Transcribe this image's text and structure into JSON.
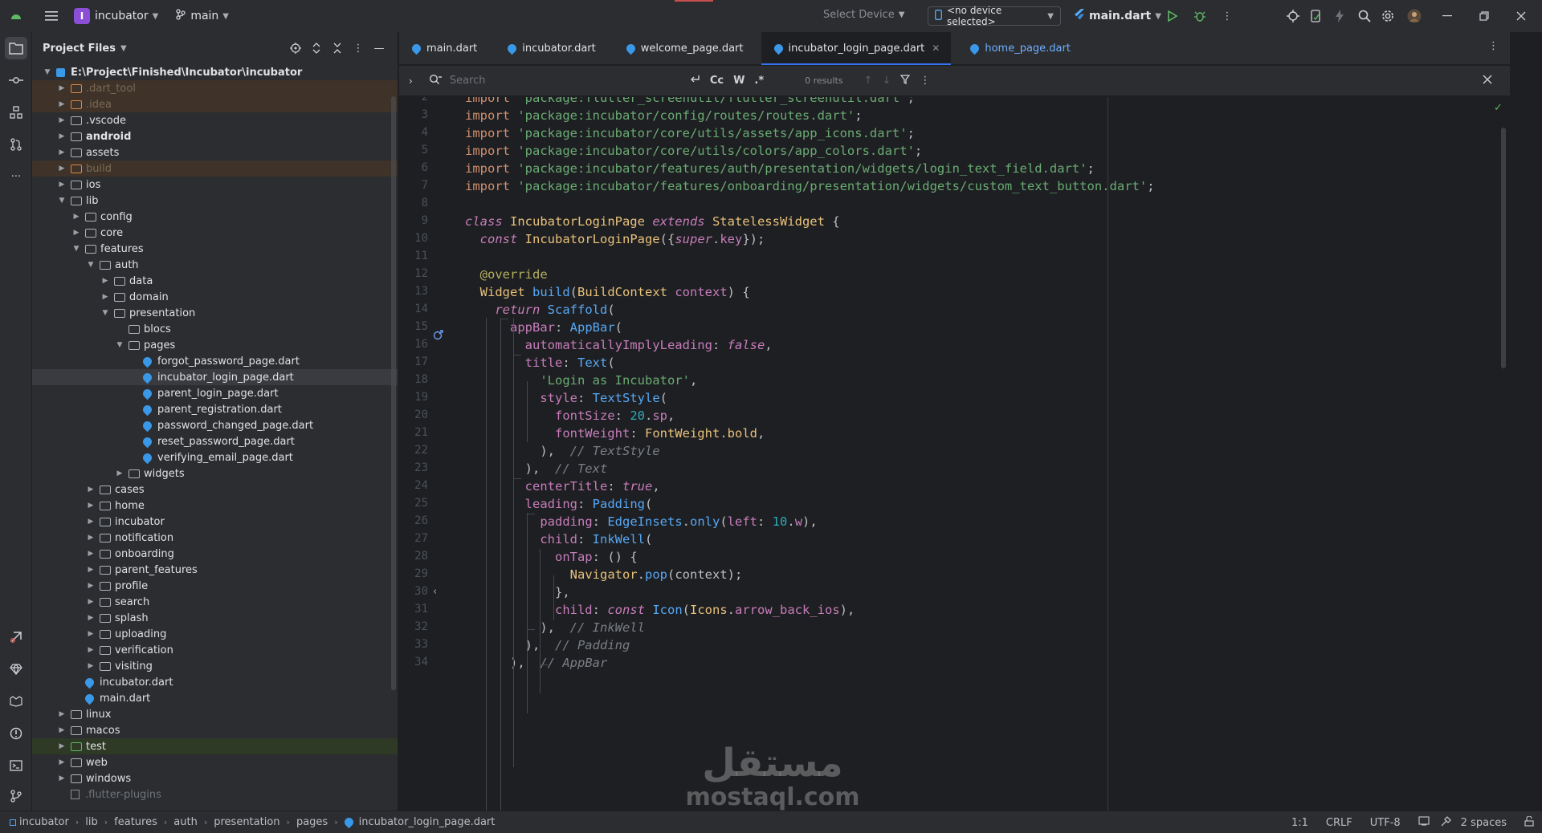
{
  "titlebar": {
    "project_badge": "I",
    "project_name": "incubator",
    "branch": "main",
    "select_device": "Select Device",
    "device_selected": "<no device selected>",
    "run_config": "main.dart",
    "brand_color": "#8a4fd6"
  },
  "project_panel": {
    "title": "Project Files",
    "tree": [
      {
        "label": "E:\\Project\\Finished\\Incubator\\incubator",
        "depth": 0,
        "expanded": true,
        "kind": "root",
        "bold": true
      },
      {
        "label": ".dart_tool",
        "depth": 1,
        "expanded": false,
        "kind": "excluded"
      },
      {
        "label": ".idea",
        "depth": 1,
        "expanded": false,
        "kind": "excluded"
      },
      {
        "label": ".vscode",
        "depth": 1,
        "expanded": false,
        "kind": "folder"
      },
      {
        "label": "android",
        "depth": 1,
        "expanded": false,
        "kind": "folder",
        "bold": true
      },
      {
        "label": "assets",
        "depth": 1,
        "expanded": false,
        "kind": "folder"
      },
      {
        "label": "build",
        "depth": 1,
        "expanded": false,
        "kind": "excluded"
      },
      {
        "label": "ios",
        "depth": 1,
        "expanded": false,
        "kind": "folder"
      },
      {
        "label": "lib",
        "depth": 1,
        "expanded": true,
        "kind": "folder"
      },
      {
        "label": "config",
        "depth": 2,
        "expanded": false,
        "kind": "folder"
      },
      {
        "label": "core",
        "depth": 2,
        "expanded": false,
        "kind": "folder"
      },
      {
        "label": "features",
        "depth": 2,
        "expanded": true,
        "kind": "folder"
      },
      {
        "label": "auth",
        "depth": 3,
        "expanded": true,
        "kind": "folder"
      },
      {
        "label": "data",
        "depth": 4,
        "expanded": false,
        "kind": "folder"
      },
      {
        "label": "domain",
        "depth": 4,
        "expanded": false,
        "kind": "folder"
      },
      {
        "label": "presentation",
        "depth": 4,
        "expanded": true,
        "kind": "folder"
      },
      {
        "label": "blocs",
        "depth": 5,
        "expanded": null,
        "kind": "folder"
      },
      {
        "label": "pages",
        "depth": 5,
        "expanded": true,
        "kind": "folder"
      },
      {
        "label": "forgot_password_page.dart",
        "depth": 6,
        "kind": "dart"
      },
      {
        "label": "incubator_login_page.dart",
        "depth": 6,
        "kind": "dart",
        "selected": true
      },
      {
        "label": "parent_login_page.dart",
        "depth": 6,
        "kind": "dart"
      },
      {
        "label": "parent_registration.dart",
        "depth": 6,
        "kind": "dart"
      },
      {
        "label": "password_changed_page.dart",
        "depth": 6,
        "kind": "dart"
      },
      {
        "label": "reset_password_page.dart",
        "depth": 6,
        "kind": "dart"
      },
      {
        "label": "verifying_email_page.dart",
        "depth": 6,
        "kind": "dart"
      },
      {
        "label": "widgets",
        "depth": 5,
        "expanded": false,
        "kind": "folder"
      },
      {
        "label": "cases",
        "depth": 3,
        "expanded": false,
        "kind": "folder"
      },
      {
        "label": "home",
        "depth": 3,
        "expanded": false,
        "kind": "folder"
      },
      {
        "label": "incubator",
        "depth": 3,
        "expanded": false,
        "kind": "folder"
      },
      {
        "label": "notification",
        "depth": 3,
        "expanded": false,
        "kind": "folder"
      },
      {
        "label": "onboarding",
        "depth": 3,
        "expanded": false,
        "kind": "folder"
      },
      {
        "label": "parent_features",
        "depth": 3,
        "expanded": false,
        "kind": "folder"
      },
      {
        "label": "profile",
        "depth": 3,
        "expanded": false,
        "kind": "folder"
      },
      {
        "label": "search",
        "depth": 3,
        "expanded": false,
        "kind": "folder"
      },
      {
        "label": "splash",
        "depth": 3,
        "expanded": false,
        "kind": "folder"
      },
      {
        "label": "uploading",
        "depth": 3,
        "expanded": false,
        "kind": "folder"
      },
      {
        "label": "verification",
        "depth": 3,
        "expanded": false,
        "kind": "folder"
      },
      {
        "label": "visiting",
        "depth": 3,
        "expanded": false,
        "kind": "folder"
      },
      {
        "label": "incubator.dart",
        "depth": 2,
        "kind": "dart"
      },
      {
        "label": "main.dart",
        "depth": 2,
        "kind": "dart"
      },
      {
        "label": "linux",
        "depth": 1,
        "expanded": false,
        "kind": "folder"
      },
      {
        "label": "macos",
        "depth": 1,
        "expanded": false,
        "kind": "folder"
      },
      {
        "label": "test",
        "depth": 1,
        "expanded": false,
        "kind": "test"
      },
      {
        "label": "web",
        "depth": 1,
        "expanded": false,
        "kind": "folder"
      },
      {
        "label": "windows",
        "depth": 1,
        "expanded": false,
        "kind": "folder"
      },
      {
        "label": ".flutter-plugins",
        "depth": 1,
        "kind": "file"
      }
    ]
  },
  "tabs": [
    {
      "label": "main.dart",
      "active": false,
      "modified": false
    },
    {
      "label": "incubator.dart",
      "active": false,
      "modified": false
    },
    {
      "label": "welcome_page.dart",
      "active": false,
      "modified": false
    },
    {
      "label": "incubator_login_page.dart",
      "active": true,
      "modified": false
    },
    {
      "label": "home_page.dart",
      "active": false,
      "modified": true
    }
  ],
  "findbar": {
    "placeholder": "Search",
    "case_label": "Cc",
    "word_label": "W",
    "regex_label": ".*",
    "results": "0 results"
  },
  "code": {
    "first_line": 2,
    "lines": [
      [
        [
          "kw",
          "import "
        ],
        [
          "str",
          "'package:flutter_screenutil/flutter_screenutil.dart'"
        ],
        [
          "txt",
          ";"
        ]
      ],
      [
        [
          "kw",
          "import "
        ],
        [
          "str",
          "'package:incubator/config/routes/routes.dart'"
        ],
        [
          "txt",
          ";"
        ]
      ],
      [
        [
          "kw",
          "import "
        ],
        [
          "str",
          "'package:incubator/core/utils/assets/app_icons.dart'"
        ],
        [
          "txt",
          ";"
        ]
      ],
      [
        [
          "kw",
          "import "
        ],
        [
          "str",
          "'package:incubator/core/utils/colors/app_colors.dart'"
        ],
        [
          "txt",
          ";"
        ]
      ],
      [
        [
          "kw",
          "import "
        ],
        [
          "str",
          "'package:incubator/features/auth/presentation/widgets/login_text_field.dart'"
        ],
        [
          "txt",
          ";"
        ]
      ],
      [
        [
          "kw",
          "import "
        ],
        [
          "str",
          "'package:incubator/features/onboarding/presentation/widgets/custom_text_button.dart'"
        ],
        [
          "txt",
          ";"
        ]
      ],
      [],
      [
        [
          "kwi",
          "class "
        ],
        [
          "cls",
          "IncubatorLoginPage "
        ],
        [
          "kwi",
          "extends "
        ],
        [
          "cls",
          "StatelessWidget "
        ],
        [
          "txt",
          "{"
        ]
      ],
      [
        [
          "txt",
          "  "
        ],
        [
          "kwi",
          "const "
        ],
        [
          "cls",
          "IncubatorLoginPage"
        ],
        [
          "txt",
          "({"
        ],
        [
          "kwi",
          "super"
        ],
        [
          "txt",
          "."
        ],
        [
          "prop",
          "key"
        ],
        [
          "txt",
          "});"
        ]
      ],
      [],
      [
        [
          "txt",
          "  "
        ],
        [
          "ann",
          "@override"
        ]
      ],
      [
        [
          "txt",
          "  "
        ],
        [
          "cls",
          "Widget "
        ],
        [
          "typ",
          "build"
        ],
        [
          "txt",
          "("
        ],
        [
          "cls",
          "BuildContext "
        ],
        [
          "prop",
          "context"
        ],
        [
          "txt",
          ") {"
        ]
      ],
      [
        [
          "txt",
          "    "
        ],
        [
          "kwi",
          "return "
        ],
        [
          "typ",
          "Scaffold"
        ],
        [
          "txt",
          "("
        ]
      ],
      [
        [
          "txt",
          "      "
        ],
        [
          "prop",
          "appBar"
        ],
        [
          "txt",
          ": "
        ],
        [
          "typ",
          "AppBar"
        ],
        [
          "txt",
          "("
        ]
      ],
      [
        [
          "txt",
          "        "
        ],
        [
          "prop",
          "automaticallyImplyLeading"
        ],
        [
          "txt",
          ": "
        ],
        [
          "kwi",
          "false"
        ],
        [
          "txt",
          ","
        ]
      ],
      [
        [
          "txt",
          "        "
        ],
        [
          "prop",
          "title"
        ],
        [
          "txt",
          ": "
        ],
        [
          "typ",
          "Text"
        ],
        [
          "txt",
          "("
        ]
      ],
      [
        [
          "txt",
          "          "
        ],
        [
          "str",
          "'Login as Incubator'"
        ],
        [
          "txt",
          ","
        ]
      ],
      [
        [
          "txt",
          "          "
        ],
        [
          "prop",
          "style"
        ],
        [
          "txt",
          ": "
        ],
        [
          "typ",
          "TextStyle"
        ],
        [
          "txt",
          "("
        ]
      ],
      [
        [
          "txt",
          "            "
        ],
        [
          "prop",
          "fontSize"
        ],
        [
          "txt",
          ": "
        ],
        [
          "num",
          "20"
        ],
        [
          "txt",
          "."
        ],
        [
          "prop",
          "sp"
        ],
        [
          "txt",
          ","
        ]
      ],
      [
        [
          "txt",
          "            "
        ],
        [
          "prop",
          "fontWeight"
        ],
        [
          "txt",
          ": "
        ],
        [
          "cls",
          "FontWeight"
        ],
        [
          "txt",
          "."
        ],
        [
          "cls",
          "bold"
        ],
        [
          "txt",
          ","
        ]
      ],
      [
        [
          "txt",
          "          ),  "
        ],
        [
          "cmt",
          "// TextStyle"
        ]
      ],
      [
        [
          "txt",
          "        ),  "
        ],
        [
          "cmt",
          "// Text"
        ]
      ],
      [
        [
          "txt",
          "        "
        ],
        [
          "prop",
          "centerTitle"
        ],
        [
          "txt",
          ": "
        ],
        [
          "kwi",
          "true"
        ],
        [
          "txt",
          ","
        ]
      ],
      [
        [
          "txt",
          "        "
        ],
        [
          "prop",
          "leading"
        ],
        [
          "txt",
          ": "
        ],
        [
          "typ",
          "Padding"
        ],
        [
          "txt",
          "("
        ]
      ],
      [
        [
          "txt",
          "          "
        ],
        [
          "prop",
          "padding"
        ],
        [
          "txt",
          ": "
        ],
        [
          "typ",
          "EdgeInsets"
        ],
        [
          "txt",
          "."
        ],
        [
          "typ",
          "only"
        ],
        [
          "txt",
          "("
        ],
        [
          "prop",
          "left"
        ],
        [
          "txt",
          ": "
        ],
        [
          "num",
          "10"
        ],
        [
          "txt",
          "."
        ],
        [
          "prop",
          "w"
        ],
        [
          "txt",
          "),"
        ]
      ],
      [
        [
          "txt",
          "          "
        ],
        [
          "prop",
          "child"
        ],
        [
          "txt",
          ": "
        ],
        [
          "typ",
          "InkWell"
        ],
        [
          "txt",
          "("
        ]
      ],
      [
        [
          "txt",
          "            "
        ],
        [
          "prop",
          "onTap"
        ],
        [
          "txt",
          ": () {"
        ]
      ],
      [
        [
          "txt",
          "              "
        ],
        [
          "cls",
          "Navigator"
        ],
        [
          "txt",
          "."
        ],
        [
          "typ",
          "pop"
        ],
        [
          "txt",
          "(context);"
        ]
      ],
      [
        [
          "txt",
          "            },"
        ]
      ],
      [
        [
          "txt",
          "            "
        ],
        [
          "prop",
          "child"
        ],
        [
          "txt",
          ": "
        ],
        [
          "kwi",
          "const "
        ],
        [
          "typ",
          "Icon"
        ],
        [
          "txt",
          "("
        ],
        [
          "cls",
          "Icons"
        ],
        [
          "txt",
          "."
        ],
        [
          "prop",
          "arrow_back_ios"
        ],
        [
          "txt",
          "),"
        ]
      ],
      [
        [
          "txt",
          "          ),  "
        ],
        [
          "cmt",
          "// InkWell"
        ]
      ],
      [
        [
          "txt",
          "        ),  "
        ],
        [
          "cmt",
          "// Padding"
        ]
      ],
      [
        [
          "txt",
          "      ),  "
        ],
        [
          "cmt",
          "// AppBar"
        ]
      ]
    ]
  },
  "watermark": {
    "arabic": "مستقل",
    "latin": "mostaql.com"
  },
  "statusbar": {
    "breadcrumbs": [
      "incubator",
      "lib",
      "features",
      "auth",
      "presentation",
      "pages",
      "incubator_login_page.dart"
    ],
    "position": "1:1",
    "line_ending": "CRLF",
    "encoding": "UTF-8",
    "indent": "2 spaces"
  }
}
